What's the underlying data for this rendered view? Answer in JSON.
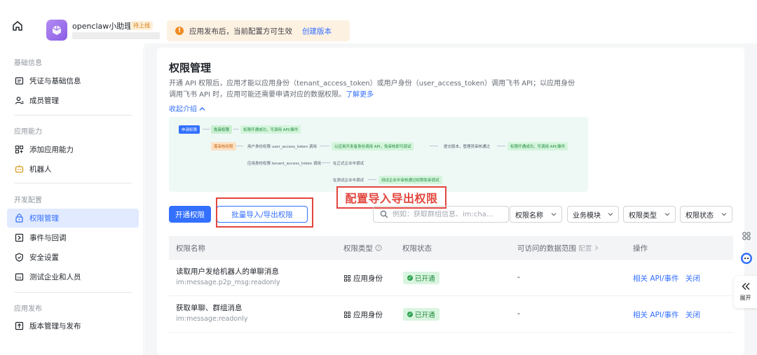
{
  "header": {
    "app_name": "openclaw小助理",
    "app_tag": "待上线",
    "notice_text": "应用发布后，当前配置方可生效",
    "notice_link": "创建版本"
  },
  "sidebar": {
    "sections": [
      {
        "title": "基础信息",
        "items": [
          {
            "label": "凭证与基础信息",
            "icon": "credential-icon"
          },
          {
            "label": "成员管理",
            "icon": "member-icon"
          }
        ]
      },
      {
        "title": "应用能力",
        "items": [
          {
            "label": "添加应用能力",
            "icon": "add-capability-icon"
          },
          {
            "label": "机器人",
            "icon": "robot-icon"
          }
        ]
      },
      {
        "title": "开发配置",
        "items": [
          {
            "label": "权限管理",
            "icon": "permission-icon",
            "active": true
          },
          {
            "label": "事件与回调",
            "icon": "event-icon"
          },
          {
            "label": "安全设置",
            "icon": "shield-icon"
          },
          {
            "label": "测试企业和人员",
            "icon": "test-icon"
          }
        ]
      },
      {
        "title": "应用发布",
        "items": [
          {
            "label": "版本管理与发布",
            "icon": "release-icon"
          }
        ]
      }
    ]
  },
  "main": {
    "title": "权限管理",
    "desc_line1": "开通 API 权限后，应用才能以应用身份（tenant_access_token）或用户身份（user_access_token）调用飞书 API；以应用身份",
    "desc_line2": "调用飞书 API 时，应用可能还需要申请对应的数据权限。",
    "desc_more": "了解更多",
    "collapse_label": "收起介绍",
    "flow": {
      "start": "申请权限",
      "no_review": "免审权限",
      "no_review_result": "权限开通成功，可调用 API/事件",
      "need_review": "需审核权限",
      "user_identity": "用户身份权限 user_access_token 调用",
      "user_result": "以应用开发者身份调用 API，免审核即可调试",
      "publish": "提交版本，管理员审核通过",
      "final": "权限开通成功，可调用 API/事件",
      "app_identity": "应用身份权限 tenant_access_token 调用",
      "enterprise": "在正式企业中调试",
      "test_enterprise": "在测试企业中调试",
      "test_result": "测试企业中审核通过权限免审调试"
    },
    "callout": "配置导入导出权限",
    "btn_open": "开通权限",
    "btn_batch": "批量导入/导出权限",
    "search_placeholder": "例如：获取群组信息、im:cha...",
    "filters": [
      "权限名称",
      "业务模块",
      "权限类型",
      "权限状态"
    ],
    "table": {
      "headers": {
        "name": "权限名称",
        "type": "权限类型",
        "status": "权限状态",
        "scope": "可访问的数据范围",
        "scope_sub": "配置",
        "action": "操作"
      },
      "rows": [
        {
          "name": "读取用户发给机器人的单聊消息",
          "code": "im:message.p2p_msg:readonly",
          "type": "应用身份",
          "status": "已开通",
          "scope": "-",
          "action_api": "相关 API/事件",
          "action_close": "关闭"
        },
        {
          "name": "获取单聊、群组消息",
          "code": "im:message:readonly",
          "type": "应用身份",
          "status": "已开通",
          "scope": "-",
          "action_api": "相关 API/事件",
          "action_close": "关闭"
        }
      ]
    }
  },
  "float": {
    "expand_label": "展开"
  },
  "colors": {
    "accent": "#3370ff",
    "active_bg": "#e1eaff",
    "annotation_red": "#e2463e",
    "success": "#1e8b3c"
  }
}
